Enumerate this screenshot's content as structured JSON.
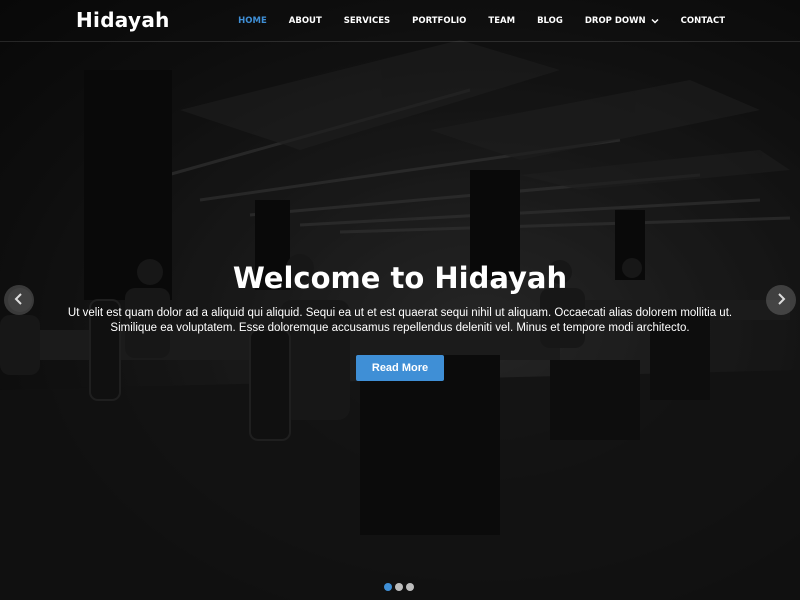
{
  "brand": {
    "logo_text": "Hidayah"
  },
  "nav": {
    "items": [
      {
        "label": "HOME",
        "active": true
      },
      {
        "label": "ABOUT"
      },
      {
        "label": "SERVICES"
      },
      {
        "label": "PORTFOLIO"
      },
      {
        "label": "TEAM"
      },
      {
        "label": "BLOG"
      },
      {
        "label": "DROP DOWN",
        "icon": "chevron-down-icon"
      },
      {
        "label": "CONTACT"
      }
    ]
  },
  "hero": {
    "title": "Welcome to Hidayah",
    "text": "Ut velit est quam dolor ad a aliquid qui aliquid. Sequi ea ut et est quaerat sequi nihil ut aliquam. Occaecati alias dolorem mollitia ut. Similique ea voluptatem. Esse doloremque accusamus repellendus deleniti vel. Minus et tempore modi architecto.",
    "button_label": "Read More"
  },
  "carousel": {
    "prev_icon": "chevron-left-icon",
    "next_icon": "chevron-right-icon",
    "slide_count": 3,
    "active_slide": 1
  },
  "colors": {
    "accent": "#3f8fd6",
    "text": "#ffffff",
    "indicator_inactive": "#bdbdbd"
  }
}
